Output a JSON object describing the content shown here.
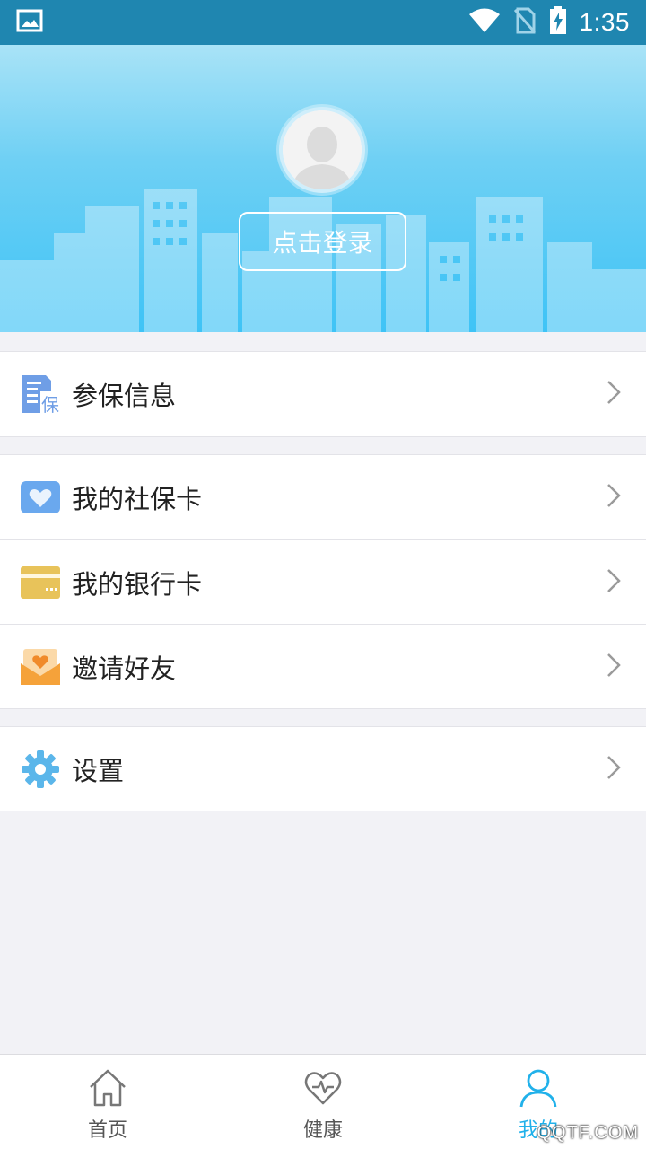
{
  "status_bar": {
    "time": "1:35",
    "icons": [
      "image-icon",
      "wifi-icon",
      "no-sim-icon",
      "battery-charging-icon"
    ]
  },
  "header": {
    "login_label": "点击登录"
  },
  "menu": {
    "group1": [
      {
        "label": "参保信息",
        "icon": "insurance-doc-icon"
      }
    ],
    "group2": [
      {
        "label": "我的社保卡",
        "icon": "social-card-icon"
      },
      {
        "label": "我的银行卡",
        "icon": "bank-card-icon"
      },
      {
        "label": "邀请好友",
        "icon": "invite-envelope-icon"
      }
    ],
    "group3": [
      {
        "label": "设置",
        "icon": "gear-icon"
      }
    ]
  },
  "bottom_nav": {
    "items": [
      {
        "label": "首页",
        "icon": "home-icon"
      },
      {
        "label": "健康",
        "icon": "heart-pulse-icon"
      },
      {
        "label": "我的",
        "icon": "person-icon",
        "active": true
      }
    ],
    "watermark": "QQTF.COM"
  },
  "colors": {
    "accent": "#21b1ea",
    "status_bar": "#1f86b0",
    "header_top": "#a9e3f7",
    "header_bottom": "#3ec3f6"
  }
}
